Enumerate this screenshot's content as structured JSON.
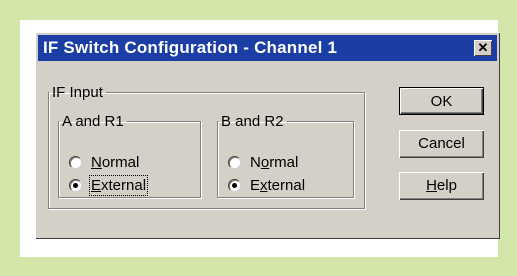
{
  "dialog": {
    "title": "IF Switch Configuration - Channel 1",
    "close_label": "x"
  },
  "if_input": {
    "legend": "IF Input",
    "group_a": {
      "legend": "A and R1",
      "normal_pre": "",
      "normal_key": "N",
      "normal_post": "ormal",
      "external_pre": "",
      "external_key": "E",
      "external_post": "xternal",
      "selected": "External"
    },
    "group_b": {
      "legend": "B and R2",
      "normal_pre": "N",
      "normal_key": "o",
      "normal_post": "rmal",
      "external_pre": "E",
      "external_key": "x",
      "external_post": "ternal",
      "selected": "External"
    }
  },
  "buttons": {
    "ok": "OK",
    "cancel": "Cancel",
    "help_key": "H",
    "help_post": "elp"
  },
  "colors": {
    "page_background": "#d3e6a9",
    "titlebar": "#1a3ea3",
    "dialog_face": "#d4d0c8"
  }
}
